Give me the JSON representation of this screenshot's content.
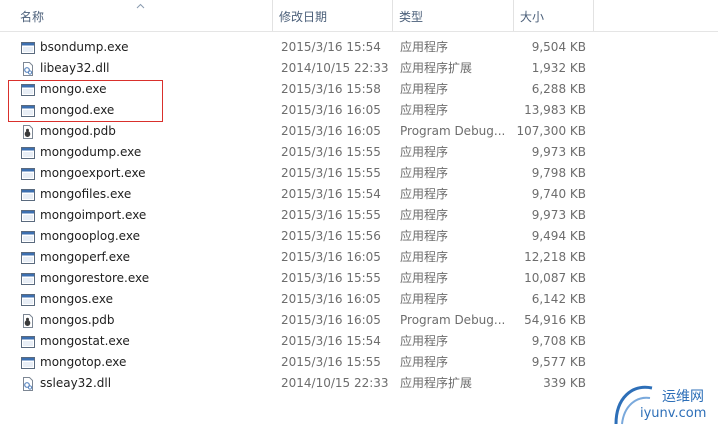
{
  "columns": {
    "name": "名称",
    "date": "修改日期",
    "type": "类型",
    "size": "大小"
  },
  "files": [
    {
      "name": "bsondump.exe",
      "date": "2015/3/16 15:54",
      "type": "应用程序",
      "size": "9,504 KB",
      "icon": "app-icon"
    },
    {
      "name": "libeay32.dll",
      "date": "2014/10/15 22:33",
      "type": "应用程序扩展",
      "size": "1,932 KB",
      "icon": "dll-icon"
    },
    {
      "name": "mongo.exe",
      "date": "2015/3/16 15:58",
      "type": "应用程序",
      "size": "6,288 KB",
      "icon": "app-icon"
    },
    {
      "name": "mongod.exe",
      "date": "2015/3/16 16:05",
      "type": "应用程序",
      "size": "13,983 KB",
      "icon": "app-icon"
    },
    {
      "name": "mongod.pdb",
      "date": "2015/3/16 16:05",
      "type": "Program Debug...",
      "size": "107,300 KB",
      "icon": "pdb-icon"
    },
    {
      "name": "mongodump.exe",
      "date": "2015/3/16 15:55",
      "type": "应用程序",
      "size": "9,973 KB",
      "icon": "app-icon"
    },
    {
      "name": "mongoexport.exe",
      "date": "2015/3/16 15:55",
      "type": "应用程序",
      "size": "9,798 KB",
      "icon": "app-icon"
    },
    {
      "name": "mongofiles.exe",
      "date": "2015/3/16 15:54",
      "type": "应用程序",
      "size": "9,740 KB",
      "icon": "app-icon"
    },
    {
      "name": "mongoimport.exe",
      "date": "2015/3/16 15:55",
      "type": "应用程序",
      "size": "9,973 KB",
      "icon": "app-icon"
    },
    {
      "name": "mongooplog.exe",
      "date": "2015/3/16 15:56",
      "type": "应用程序",
      "size": "9,494 KB",
      "icon": "app-icon"
    },
    {
      "name": "mongoperf.exe",
      "date": "2015/3/16 16:05",
      "type": "应用程序",
      "size": "12,218 KB",
      "icon": "app-icon"
    },
    {
      "name": "mongorestore.exe",
      "date": "2015/3/16 15:55",
      "type": "应用程序",
      "size": "10,087 KB",
      "icon": "app-icon"
    },
    {
      "name": "mongos.exe",
      "date": "2015/3/16 16:05",
      "type": "应用程序",
      "size": "6,142 KB",
      "icon": "app-icon"
    },
    {
      "name": "mongos.pdb",
      "date": "2015/3/16 16:05",
      "type": "Program Debug...",
      "size": "54,916 KB",
      "icon": "pdb-icon"
    },
    {
      "name": "mongostat.exe",
      "date": "2015/3/16 15:54",
      "type": "应用程序",
      "size": "9,708 KB",
      "icon": "app-icon"
    },
    {
      "name": "mongotop.exe",
      "date": "2015/3/16 15:55",
      "type": "应用程序",
      "size": "9,577 KB",
      "icon": "app-icon"
    },
    {
      "name": "ssleay32.dll",
      "date": "2014/10/15 22:33",
      "type": "应用程序扩展",
      "size": "339 KB",
      "icon": "dll-icon"
    }
  ],
  "watermark": {
    "line1": "运维网",
    "line2": "iyunv.com"
  },
  "colors": {
    "highlight_border": "#d9302c",
    "header_text": "#4c607a",
    "meta_text": "#6d6d6d"
  }
}
